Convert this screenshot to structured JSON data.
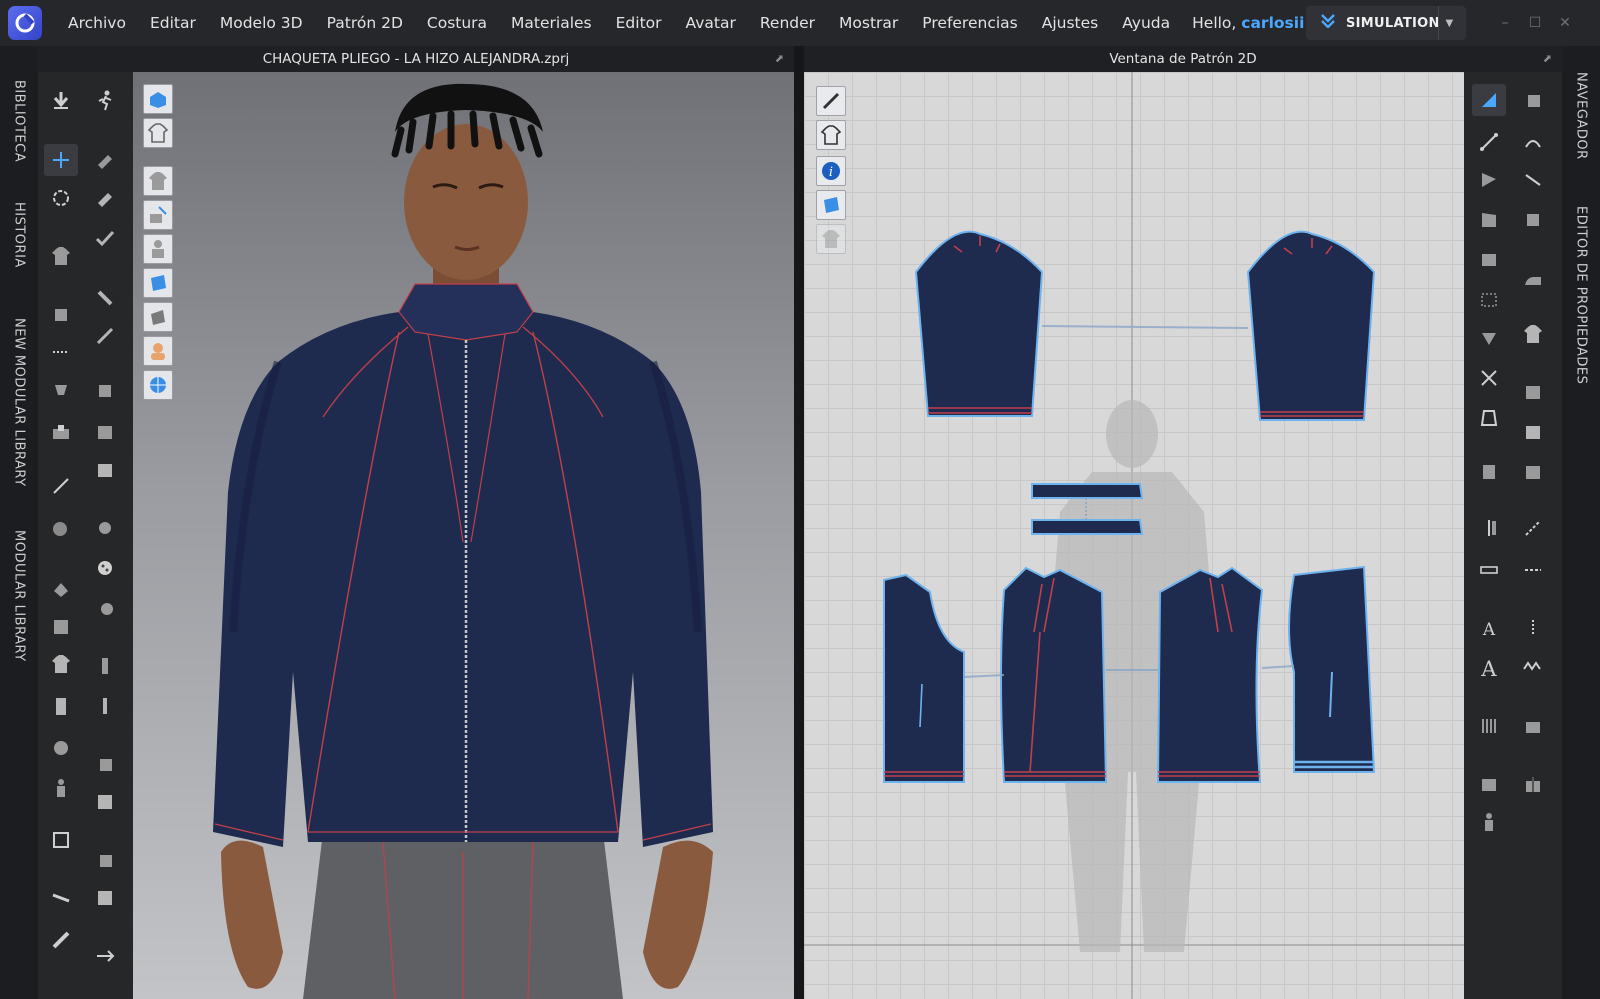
{
  "menubar": {
    "items": [
      "Archivo",
      "Editar",
      "Modelo 3D",
      "Patrón 2D",
      "Costura",
      "Materiales",
      "Editor",
      "Avatar",
      "Render",
      "Mostrar",
      "Preferencias",
      "Ajustes",
      "Ayuda"
    ],
    "hello_prefix": "Hello, ",
    "user": "carlosii",
    "mode_label": "SIMULATION",
    "window_controls": [
      "–",
      "☐",
      "✕"
    ]
  },
  "left_tabs": [
    "BIBLIOTECA",
    "HISTORIA",
    "NEW MODULAR LIBRARY",
    "MODULAR LIBRARY"
  ],
  "right_tabs": [
    "NAVEGADOR",
    "EDITOR DE PROPIEDADES"
  ],
  "panel3d": {
    "title": "CHAQUETA PLIEGO - LA HIZO ALEJANDRA.zprj"
  },
  "panel2d": {
    "title": "Ventana de Patrón 2D"
  },
  "colors": {
    "accent": "#4aa8ff",
    "garment": "#1f2a4f",
    "topstitch": "#c0404a",
    "pattern_outline": "#6fb3ee",
    "pants": "#5f6063",
    "skin": "#8a5a3e"
  },
  "icons": {
    "app_logo": "clo-logo-icon",
    "cloud": "cloud-sync-icon",
    "simulation": "simulation-chevron-icon"
  }
}
